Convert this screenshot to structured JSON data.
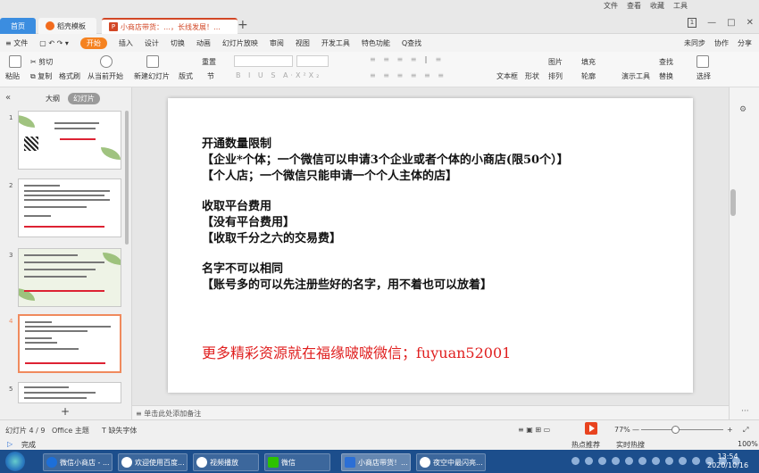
{
  "top_menu": [
    "文件",
    "查看",
    "收藏",
    "工具"
  ],
  "tabs": {
    "home": "首页",
    "template": "稻壳模板",
    "document": "小商店带货：…，长线发展！…",
    "add": "+"
  },
  "menubar": {
    "items": [
      "≡ 文件",
      "开始",
      "插入",
      "设计",
      "切换",
      "动画",
      "幻灯片放映",
      "审阅",
      "视图",
      "开发工具",
      "特色功能"
    ],
    "active": "开始",
    "search": "Q查找",
    "right": [
      "未同步",
      "协作",
      "分享"
    ]
  },
  "ribbon": {
    "paste": "粘贴",
    "cut": "剪切",
    "copy": "复制",
    "format_painter": "格式刷",
    "play_from_current": "从当前开始",
    "new_slide": "新建幻灯片",
    "layout": "版式",
    "section": "节",
    "reset": "重置",
    "textbox": "文本框",
    "shape": "形状",
    "arrange": "排列",
    "picture": "图片",
    "fill": "填充",
    "outline": "轮廓",
    "present_tools": "演示工具",
    "find": "查找",
    "replace": "替换",
    "select": "选择"
  },
  "left_panel": {
    "outline_tab": "大纲",
    "slides_tab": "幻灯片",
    "slide_numbers": [
      "1",
      "2",
      "3",
      "4",
      "5"
    ],
    "add_slide": "+"
  },
  "slide": {
    "lines": [
      "开通数量限制",
      "【企业*个体；一个微信可以申请3个企业或者个体的小商店(限50个）】",
      "【个人店；一个微信只能申请一个个人主体的店】",
      "收取平台费用",
      "【没有平台费用】",
      "【收取千分之六的交易费】",
      "名字不可以相同",
      "【账号多的可以先注册些好的名字，用不着也可以放着】"
    ],
    "promo": "更多精彩资源就在福缘啵啵微信；fuyuan52001"
  },
  "notes_placeholder": "单击此处添加备注",
  "statusbar": {
    "slide_count": "幻灯片 4 / 9",
    "theme": "Office 主题",
    "font_missing": "缺失字体",
    "zoom": "77%",
    "zoom_fraction": 0.42
  },
  "bottomline": {
    "status": "完成",
    "hot": "热点推荐",
    "realtime": "实时热搜",
    "percent": "100%"
  },
  "taskbar": {
    "items": [
      "微信小商店 - ...",
      "欢迎使用百度...",
      "视频播放",
      "微信",
      "小商店带货！...",
      "夜空中最闪亮..."
    ],
    "time": "13:54",
    "date": "2020/10/16"
  }
}
